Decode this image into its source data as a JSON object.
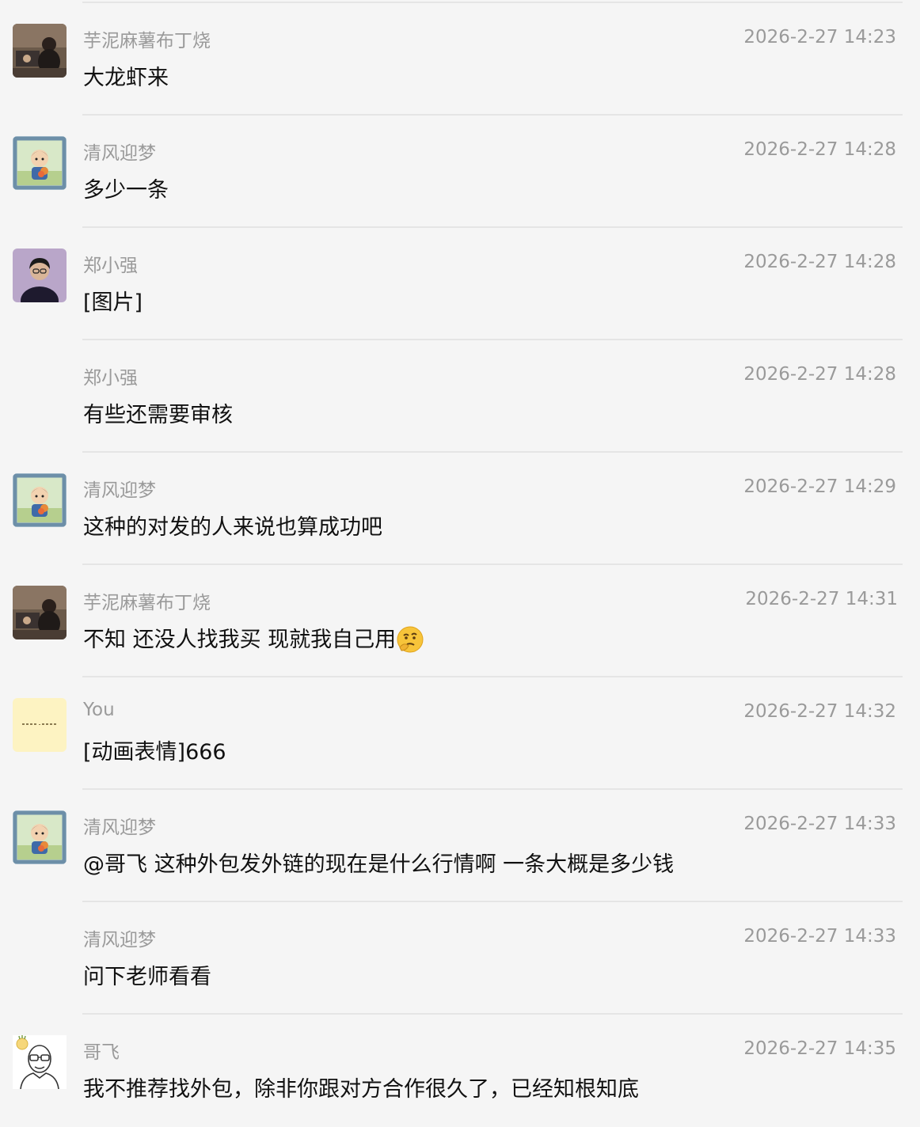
{
  "messages": [
    {
      "sender": "芋泥麻薯布丁烧",
      "time": "2026-2-27 14:23",
      "text": "大龙虾来",
      "avatar": "photo-avatar-icon"
    },
    {
      "sender": "清风迎梦",
      "time": "2026-2-27 14:28",
      "text": "多少一条",
      "avatar": "cartoon-boy-avatar-icon"
    },
    {
      "sender": "郑小强",
      "time": "2026-2-27 14:28",
      "text": "[图片]",
      "avatar": "portrait-avatar-icon"
    },
    {
      "sender": "郑小强",
      "time": "2026-2-27 14:28",
      "text": "有些还需要审核",
      "avatar": ""
    },
    {
      "sender": "清风迎梦",
      "time": "2026-2-27 14:29",
      "text": "这种的对发的人来说也算成功吧",
      "avatar": "cartoon-boy-avatar-icon"
    },
    {
      "sender": "芋泥麻薯布丁烧",
      "time": "2026-2-27 14:31",
      "text": "不知 还没人找我买 现就我自己用",
      "avatar": "photo-avatar-icon",
      "emoji": "thinking-face-emoji-icon"
    },
    {
      "sender": "You",
      "time": "2026-2-27 14:32",
      "text": "[动画表情]666",
      "avatar": "yellow-note-avatar-icon"
    },
    {
      "sender": "清风迎梦",
      "time": "2026-2-27 14:33",
      "text": "@哥飞 这种外包发外链的现在是什么行情啊  一条大概是多少钱",
      "avatar": "cartoon-boy-avatar-icon"
    },
    {
      "sender": "清风迎梦",
      "time": "2026-2-27 14:33",
      "text": "问下老师看看",
      "avatar": ""
    },
    {
      "sender": "哥飞",
      "time": "2026-2-27 14:35",
      "text": "我不推荐找外包，除非你跟对方合作很久了，已经知根知底",
      "avatar": "glasses-man-sketch-avatar-icon"
    }
  ],
  "colors": {
    "background": "#f5f5f5",
    "divider": "#e5e5e5",
    "meta_text": "#9a9a9a",
    "message_text": "#111111"
  }
}
